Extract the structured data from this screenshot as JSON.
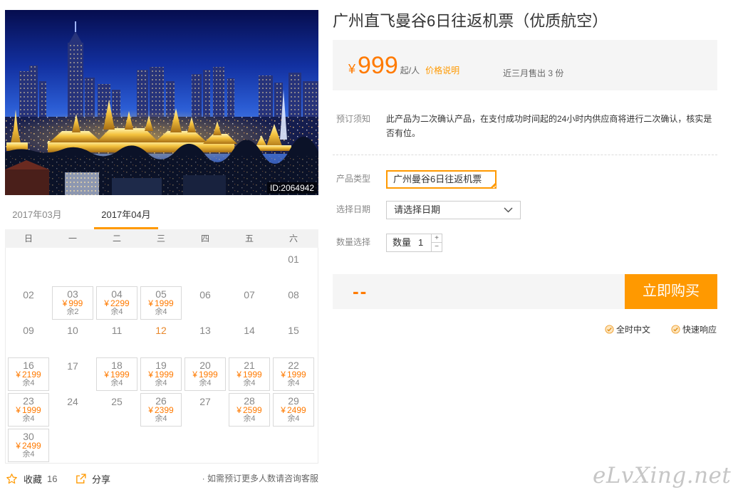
{
  "colors": {
    "accent": "#ff9900",
    "price": "#ff7a00",
    "panel": "#f5f5f5",
    "text": "#333333",
    "muted": "#888888",
    "highlight": "#e8872a"
  },
  "icons": {
    "favorite": "star-icon",
    "share": "share-icon",
    "date_dropdown": "chevron-down-icon",
    "guarantee": "check-circle-icon",
    "selected_option": "check-corner-icon"
  },
  "product": {
    "title": "广州直飞曼谷6日往返机票（优质航空）",
    "image_id": "ID:2064942"
  },
  "calendar": {
    "months": [
      {
        "label": "2017年03月",
        "active": false
      },
      {
        "label": "2017年04月",
        "active": true
      }
    ],
    "weekdays": [
      "日",
      "一",
      "二",
      "三",
      "四",
      "五",
      "六"
    ],
    "currency": "¥",
    "weeks": [
      [
        null,
        null,
        null,
        null,
        null,
        null,
        {
          "day": "01"
        }
      ],
      [
        {
          "day": "02"
        },
        {
          "day": "03",
          "price": "999",
          "stock": "余2"
        },
        {
          "day": "04",
          "price": "2299",
          "stock": "余4"
        },
        {
          "day": "05",
          "price": "1999",
          "stock": "余4"
        },
        {
          "day": "06"
        },
        {
          "day": "07"
        },
        {
          "day": "08"
        }
      ],
      [
        {
          "day": "09"
        },
        {
          "day": "10"
        },
        {
          "day": "11"
        },
        {
          "day": "12",
          "highlighted": true
        },
        {
          "day": "13"
        },
        {
          "day": "14"
        },
        {
          "day": "15"
        }
      ],
      [
        {
          "day": "16",
          "price": "2199",
          "stock": "余4"
        },
        {
          "day": "17"
        },
        {
          "day": "18",
          "price": "1999",
          "stock": "余4"
        },
        {
          "day": "19",
          "price": "1999",
          "stock": "余4"
        },
        {
          "day": "20",
          "price": "1999",
          "stock": "余4"
        },
        {
          "day": "21",
          "price": "1999",
          "stock": "余4"
        },
        {
          "day": "22",
          "price": "1999",
          "stock": "余4"
        }
      ],
      [
        {
          "day": "23",
          "price": "1999",
          "stock": "余4"
        },
        {
          "day": "24"
        },
        {
          "day": "25"
        },
        {
          "day": "26",
          "price": "2399",
          "stock": "余4"
        },
        {
          "day": "27"
        },
        {
          "day": "28",
          "price": "2599",
          "stock": "余4"
        },
        {
          "day": "29",
          "price": "2499",
          "stock": "余4"
        }
      ],
      [
        {
          "day": "30",
          "price": "2499",
          "stock": "余4"
        },
        null,
        null,
        null,
        null,
        null,
        null
      ]
    ]
  },
  "actions": {
    "favorite_label": "收藏",
    "favorite_count": "16",
    "share_label": "分享",
    "note": "· 如需预订更多人数请咨询客服"
  },
  "price": {
    "currency": "¥",
    "amount": "999",
    "unit": "起/人",
    "explain_link": "价格说明",
    "sales": "近三月售出 3 份"
  },
  "notice": {
    "label": "预订须知",
    "text": "此产品为二次确认产品，在支付成功时间起的24小时内供应商将进行二次确认，核实是否有位。"
  },
  "options": {
    "type_label": "产品类型",
    "type_value": "广州曼谷6日往返机票",
    "date_label": "选择日期",
    "date_placeholder": "请选择日期",
    "qty_label": "数量选择",
    "qty_prefix": "数量",
    "qty_value": "1",
    "plus": "+",
    "minus": "−"
  },
  "buy": {
    "total": "--",
    "button": "立即购买"
  },
  "guarantees": [
    "全时中文",
    "快速响应"
  ],
  "watermark": "eLvXing.net"
}
